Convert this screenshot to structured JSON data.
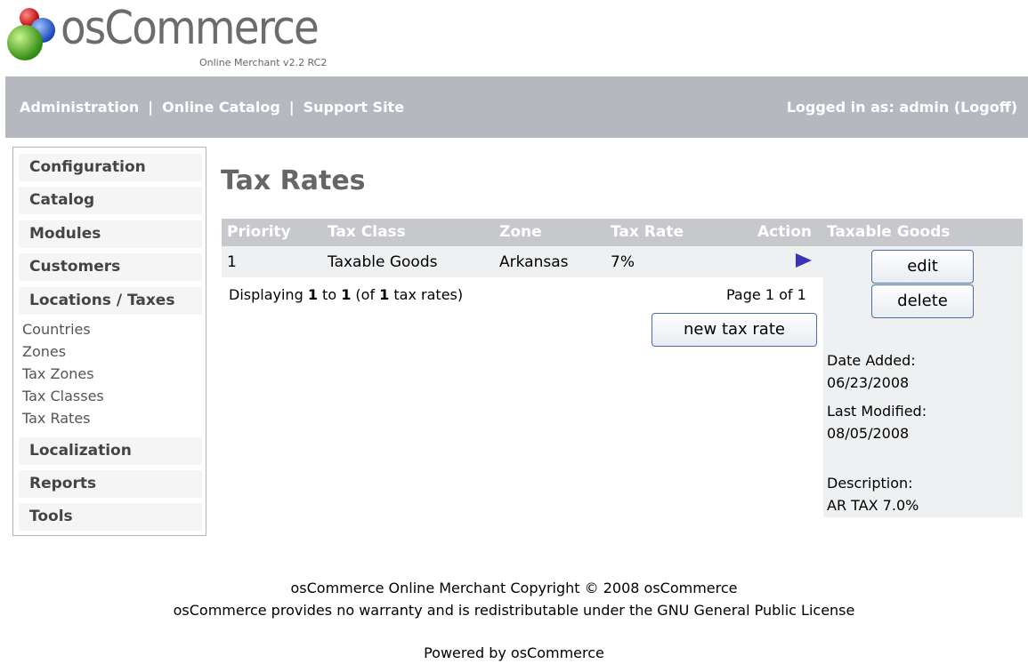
{
  "logo": {
    "text": "osCommerce",
    "subtitle": "Online Merchant v2.2 RC2"
  },
  "header": {
    "links": [
      "Administration",
      "Online Catalog",
      "Support Site"
    ],
    "separator": "|",
    "logged_in_prefix": "Logged in as: admin",
    "logoff": "(Logoff)"
  },
  "sidebar": {
    "boxes": [
      "Configuration",
      "Catalog",
      "Modules",
      "Customers",
      "Locations / Taxes",
      "Localization",
      "Reports",
      "Tools"
    ],
    "sub_items": [
      "Countries",
      "Zones",
      "Tax Zones",
      "Tax Classes",
      "Tax Rates"
    ]
  },
  "main": {
    "title": "Tax Rates",
    "columns": [
      "Priority",
      "Tax Class",
      "Zone",
      "Tax Rate",
      "Action"
    ],
    "rows": [
      {
        "priority": "1",
        "tax_class": "Taxable Goods",
        "zone": "Arkansas",
        "tax_rate": "7%"
      }
    ],
    "displaying": {
      "prefix": "Displaying ",
      "from": "1",
      "to_word": " to ",
      "to": "1",
      "of_word": " (of ",
      "total": "1",
      "suffix": " tax rates)"
    },
    "page_info": "Page 1 of 1",
    "new_button": "new tax rate"
  },
  "info_panel": {
    "heading": "Taxable Goods",
    "edit_button": "edit",
    "delete_button": "delete",
    "date_added_label": "Date Added:",
    "date_added": "06/23/2008",
    "last_modified_label": "Last Modified:",
    "last_modified": "08/05/2008",
    "description_label": "Description:",
    "description": "AR TAX 7.0%"
  },
  "footer": {
    "line1": "osCommerce Online Merchant Copyright © 2008 osCommerce",
    "line2": "osCommerce provides no warranty and is redistributable under the GNU General Public License",
    "powered": "Powered by osCommerce"
  },
  "colors": {
    "header_bar": "#b5b9bf",
    "table_head": "#c6c8cb",
    "row_bg": "#eef0f2",
    "action_arrow": "#3b33b3"
  }
}
